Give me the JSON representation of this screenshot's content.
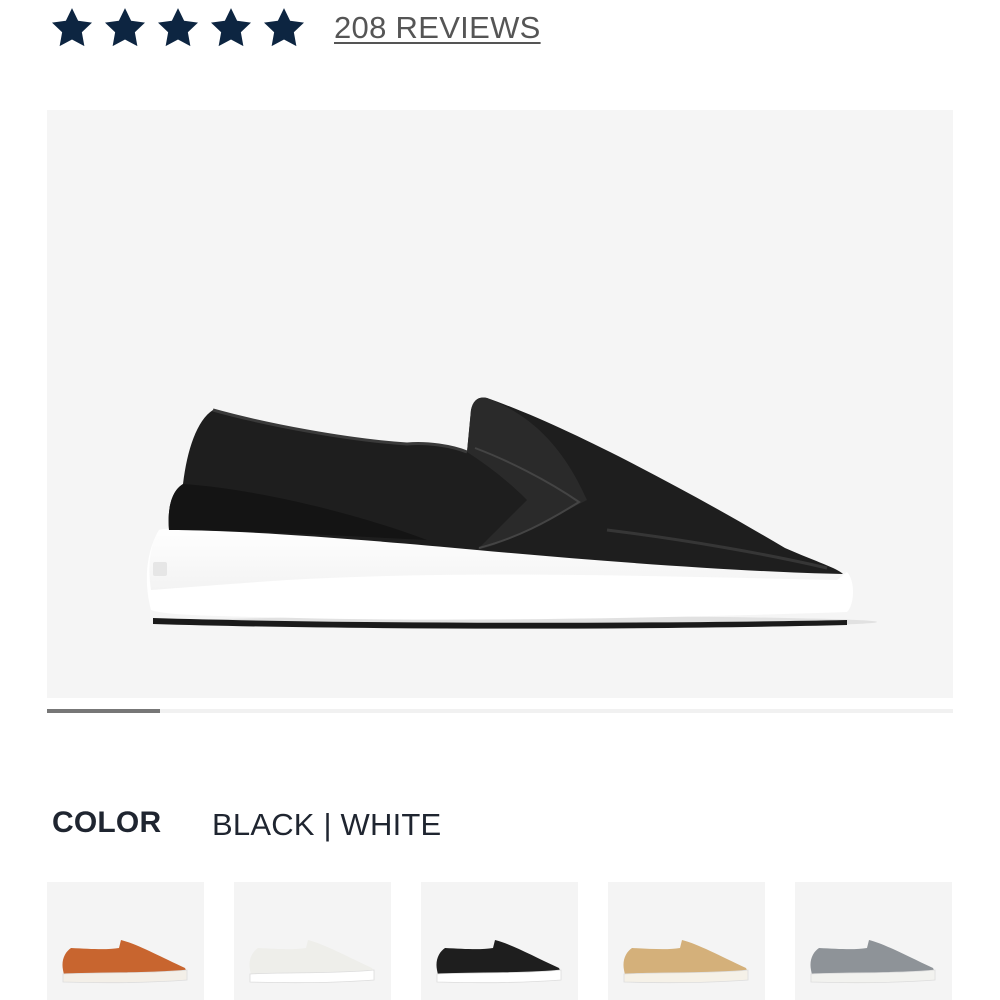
{
  "rating": {
    "stars": 5,
    "star_color": "#0d2541",
    "reviews_label": "208 REVIEWS"
  },
  "product_image": {
    "icon": "black-slip-on-sneaker",
    "upper_color": "#1e1e1e",
    "sole_color": "#ffffff"
  },
  "gallery": {
    "progress_fraction": 0.125,
    "track_color": "#f1f1f1",
    "fill_color": "#777777"
  },
  "color_selector": {
    "label": "COLOR",
    "selected_value": "BLACK | WHITE",
    "swatches": [
      {
        "icon": "orange-slip-on-sneaker",
        "upper": "#c8652f",
        "sole": "#f3efe8"
      },
      {
        "icon": "white-slip-on-sneaker",
        "upper": "#eeeeea",
        "sole": "#ffffff"
      },
      {
        "icon": "black-slip-on-sneaker",
        "upper": "#1e1e1e",
        "sole": "#ffffff"
      },
      {
        "icon": "tan-slip-on-sneaker",
        "upper": "#d4b07a",
        "sole": "#f5f1e8"
      },
      {
        "icon": "grey-slip-on-sneaker",
        "upper": "#8e9398",
        "sole": "#f2f2ef"
      }
    ]
  }
}
